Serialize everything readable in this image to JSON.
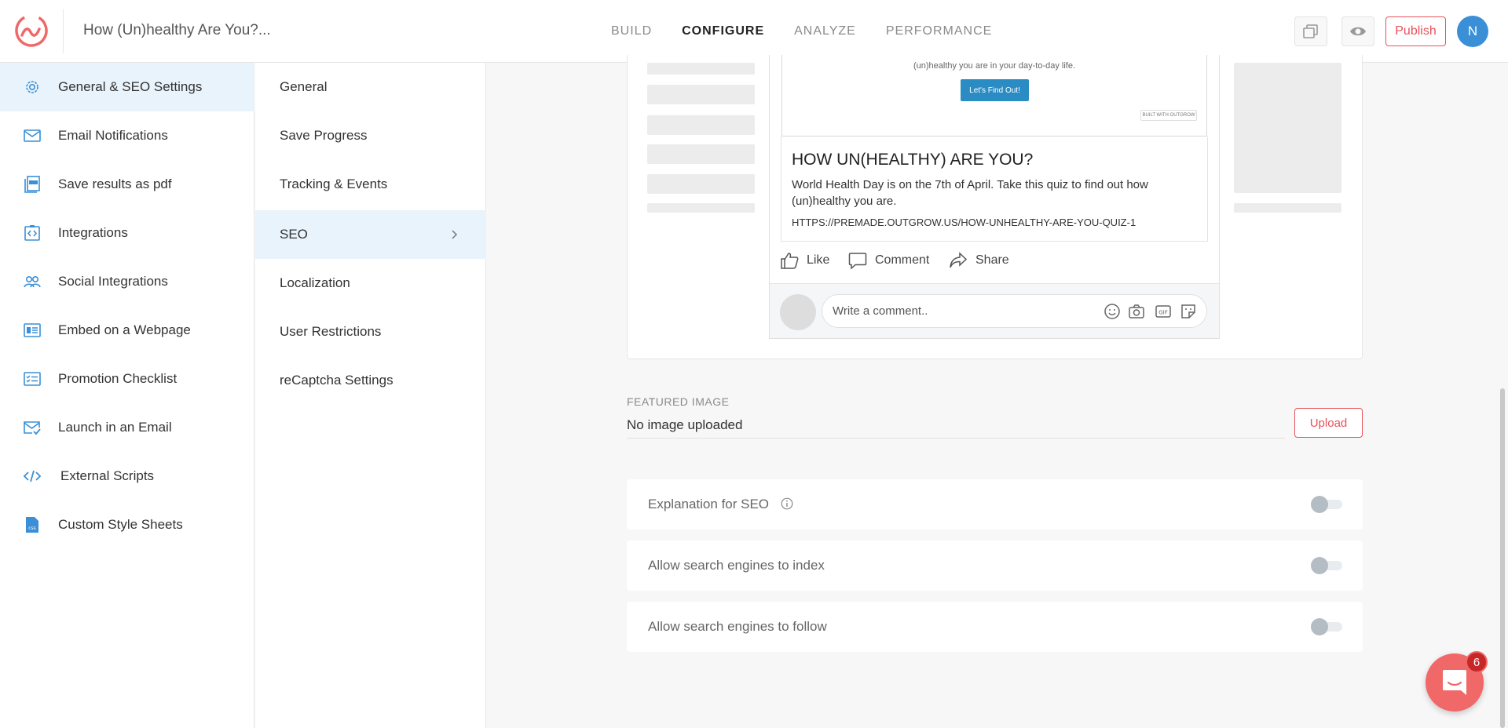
{
  "header": {
    "title": "How (Un)healthy Are You?...",
    "nav": [
      "BUILD",
      "CONFIGURE",
      "ANALYZE",
      "PERFORMANCE"
    ],
    "active_nav": "CONFIGURE",
    "publish_label": "Publish",
    "avatar_initial": "N"
  },
  "sidebar": {
    "items": [
      {
        "label": "General & SEO Settings",
        "icon": "gear-icon",
        "active": true
      },
      {
        "label": "Email Notifications",
        "icon": "envelope-icon"
      },
      {
        "label": "Save results as pdf",
        "icon": "pdf-icon"
      },
      {
        "label": "Integrations",
        "icon": "integrations-icon"
      },
      {
        "label": "Social Integrations",
        "icon": "users-icon"
      },
      {
        "label": "Embed on a Webpage",
        "icon": "embed-icon"
      },
      {
        "label": "Promotion Checklist",
        "icon": "checklist-icon"
      },
      {
        "label": "Launch in an Email",
        "icon": "email-check-icon"
      },
      {
        "label": "External Scripts",
        "icon": "code-icon"
      },
      {
        "label": "Custom Style Sheets",
        "icon": "css-file-icon"
      }
    ]
  },
  "subnav": {
    "items": [
      {
        "label": "General"
      },
      {
        "label": "Save Progress"
      },
      {
        "label": "Tracking & Events"
      },
      {
        "label": "SEO",
        "active": true
      },
      {
        "label": "Localization"
      },
      {
        "label": "User Restrictions"
      },
      {
        "label": "reCaptcha Settings"
      }
    ]
  },
  "preview": {
    "shot_text": "(un)healthy you are in your day-to-day life.",
    "shot_button": "Let's Find Out!",
    "shot_badge": "BUILT WITH OUTGROW",
    "title": "HOW UN(HEALTHY) ARE YOU?",
    "description": "World Health Day is on the 7th of April. Take this quiz to find out how (un)healthy you are.",
    "url": "HTTPS://PREMADE.OUTGROW.US/HOW-UNHEALTHY-ARE-YOU-QUIZ-1",
    "actions": {
      "like": "Like",
      "comment": "Comment",
      "share": "Share"
    },
    "comment_placeholder": "Write a comment.."
  },
  "featured_image": {
    "label": "FEATURED IMAGE",
    "value": "No image uploaded",
    "upload_label": "Upload"
  },
  "toggles": [
    {
      "label": "Explanation for SEO",
      "on": false
    },
    {
      "label": "Allow search engines to index",
      "on": false
    },
    {
      "label": "Allow search engines to follow",
      "on": false
    }
  ],
  "chat": {
    "badge": "6"
  },
  "colors": {
    "accent": "#e8525a",
    "link": "#3a8fd6",
    "active_bg": "#e8f3fb"
  }
}
